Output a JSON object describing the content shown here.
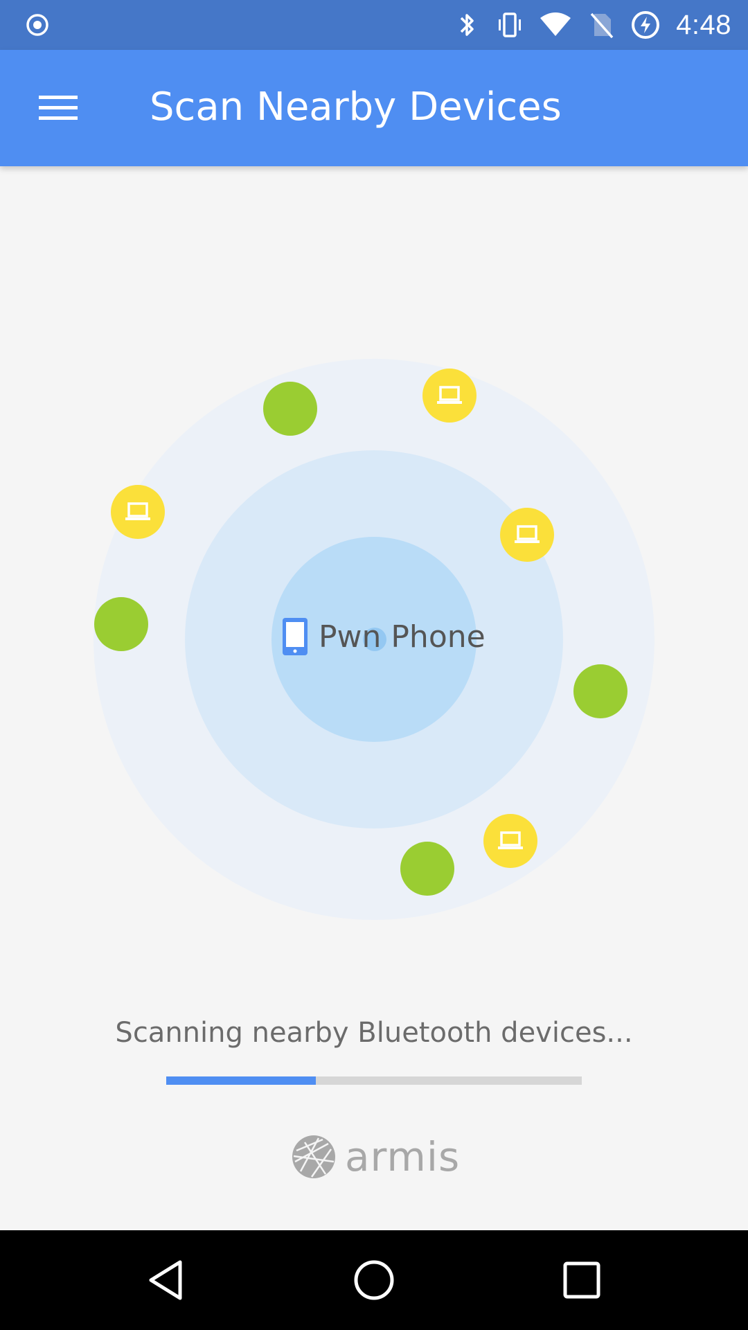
{
  "status_bar": {
    "time": "4:48",
    "icons": [
      "record-icon",
      "bluetooth-icon",
      "vibrate-icon",
      "wifi-icon",
      "no-sim-icon",
      "battery-charging-icon"
    ]
  },
  "app_bar": {
    "title": "Scan Nearby Devices",
    "menu_icon": "menu-icon"
  },
  "radar": {
    "self_device_label": "Pwn Phone",
    "devices": [
      {
        "type": "unknown",
        "color": "#9acd32"
      },
      {
        "type": "laptop",
        "color": "#fbe03a"
      },
      {
        "type": "laptop",
        "color": "#fbe03a"
      },
      {
        "type": "laptop",
        "color": "#fbe03a"
      },
      {
        "type": "unknown",
        "color": "#9acd32"
      },
      {
        "type": "unknown",
        "color": "#9acd32"
      },
      {
        "type": "laptop",
        "color": "#fbe03a"
      },
      {
        "type": "unknown",
        "color": "#9acd32"
      }
    ]
  },
  "scan": {
    "status_text": "Scanning nearby Bluetooth devices...",
    "progress": 0.36
  },
  "brand": {
    "logo_text": "armis"
  },
  "colors": {
    "status_bar": "#4577c8",
    "app_bar": "#4f8ef2",
    "accent": "#4f8ef2",
    "device_unknown": "#9acd32",
    "device_laptop": "#fbe03a"
  }
}
